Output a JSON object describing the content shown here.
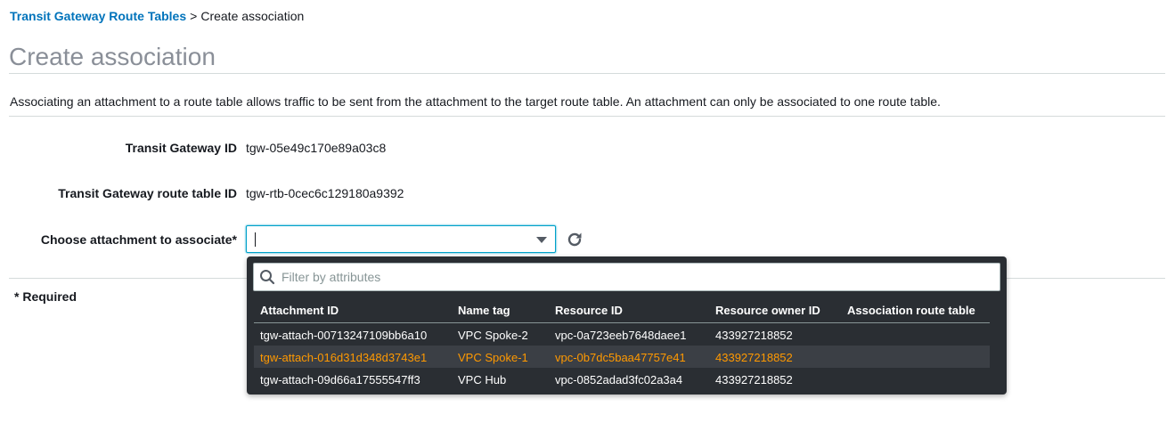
{
  "breadcrumb": {
    "parent": "Transit Gateway Route Tables",
    "separator": ">",
    "current": "Create association"
  },
  "title": "Create association",
  "description": "Associating an attachment to a route table allows traffic to be sent from the attachment to the target route table. An attachment can only be associated to one route table.",
  "form": {
    "tgw_id_label": "Transit Gateway ID",
    "tgw_id_value": "tgw-05e49c170e89a03c8",
    "rtb_id_label": "Transit Gateway route table ID",
    "rtb_id_value": "tgw-rtb-0cec6c129180a9392",
    "attachment_label": "Choose attachment to associate*",
    "attachment_value": ""
  },
  "required_note": "* Required",
  "dropdown": {
    "filter_placeholder": "Filter by attributes",
    "columns": [
      "Attachment ID",
      "Name tag",
      "Resource ID",
      "Resource owner ID",
      "Association route table"
    ],
    "rows": [
      [
        "tgw-attach-00713247109bb6a10",
        "VPC Spoke-2",
        "vpc-0a723eeb7648daee1",
        "433927218852",
        ""
      ],
      [
        "tgw-attach-016d31d348d3743e1",
        "VPC Spoke-1",
        "vpc-0b7dc5baa47757e41",
        "433927218852",
        ""
      ],
      [
        "tgw-attach-09d66a17555547ff3",
        "VPC Hub",
        "vpc-0852adad3fc02a3a4",
        "433927218852",
        ""
      ]
    ],
    "highlighted_row": 1
  },
  "colors": {
    "link": "#0073bb",
    "focus": "#00a1c9",
    "dropdown_bg": "#2a2e33",
    "highlight_text": "#ff9900"
  },
  "icons": {
    "refresh": "refresh-icon",
    "search": "search-icon",
    "dropdown": "chevron-down-icon"
  }
}
